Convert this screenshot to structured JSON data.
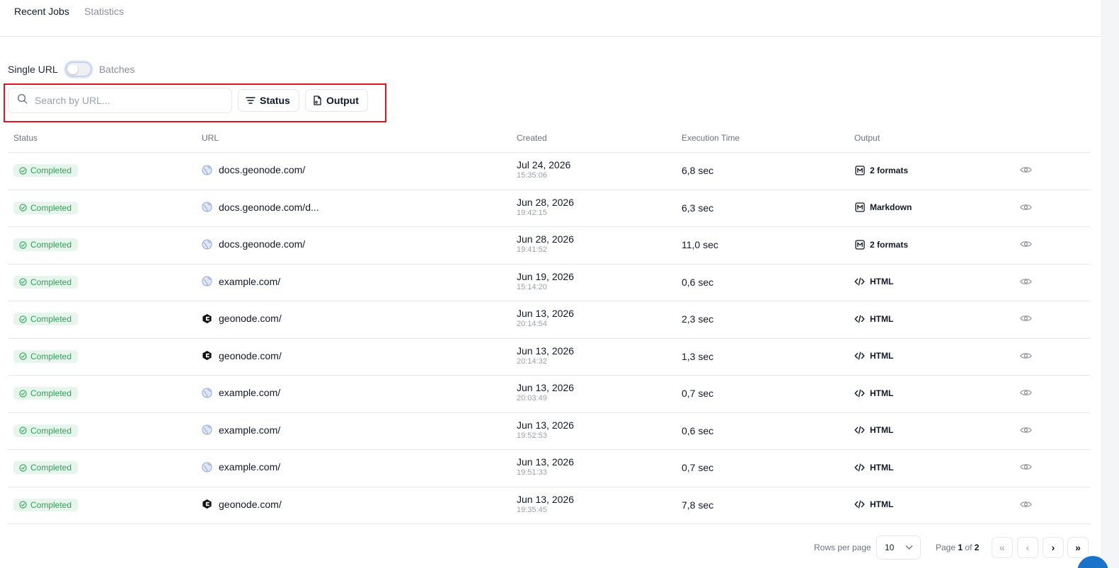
{
  "tabs": {
    "active": "Recent Jobs",
    "inactive": "Statistics"
  },
  "mode": {
    "left_label": "Single URL",
    "right_label": "Batches",
    "toggle_on": false
  },
  "filters": {
    "search_placeholder": "Search by URL...",
    "status_label": "Status",
    "output_label": "Output",
    "highlight_color": "#e0131f"
  },
  "table": {
    "headers": {
      "status": "Status",
      "url": "URL",
      "created": "Created",
      "execution_time": "Execution Time",
      "output": "Output"
    },
    "rows": [
      {
        "status": "Completed",
        "url": "docs.geonode.com/",
        "url_icon": "globe-icon",
        "date": "Jul 24, 2026",
        "time": "15:35:06",
        "exec": "6,8 sec",
        "output": "2 formats",
        "output_icon": "markdown-icon"
      },
      {
        "status": "Completed",
        "url": "docs.geonode.com/d...",
        "url_icon": "globe-icon",
        "date": "Jun 28, 2026",
        "time": "19:42:15",
        "exec": "6,3 sec",
        "output": "Markdown",
        "output_icon": "markdown-icon"
      },
      {
        "status": "Completed",
        "url": "docs.geonode.com/",
        "url_icon": "globe-icon",
        "date": "Jun 28, 2026",
        "time": "19:41:52",
        "exec": "11,0 sec",
        "output": "2 formats",
        "output_icon": "markdown-icon"
      },
      {
        "status": "Completed",
        "url": "example.com/",
        "url_icon": "globe-icon",
        "date": "Jun 19, 2026",
        "time": "15:14:20",
        "exec": "0,6 sec",
        "output": "HTML",
        "output_icon": "code-icon"
      },
      {
        "status": "Completed",
        "url": "geonode.com/",
        "url_icon": "geonode-logo-icon",
        "date": "Jun 13, 2026",
        "time": "20:14:54",
        "exec": "2,3 sec",
        "output": "HTML",
        "output_icon": "code-icon"
      },
      {
        "status": "Completed",
        "url": "geonode.com/",
        "url_icon": "geonode-logo-icon",
        "date": "Jun 13, 2026",
        "time": "20:14:32",
        "exec": "1,3 sec",
        "output": "HTML",
        "output_icon": "code-icon"
      },
      {
        "status": "Completed",
        "url": "example.com/",
        "url_icon": "globe-icon",
        "date": "Jun 13, 2026",
        "time": "20:03:49",
        "exec": "0,7 sec",
        "output": "HTML",
        "output_icon": "code-icon"
      },
      {
        "status": "Completed",
        "url": "example.com/",
        "url_icon": "globe-icon",
        "date": "Jun 13, 2026",
        "time": "19:52:53",
        "exec": "0,6 sec",
        "output": "HTML",
        "output_icon": "code-icon"
      },
      {
        "status": "Completed",
        "url": "example.com/",
        "url_icon": "globe-icon",
        "date": "Jun 13, 2026",
        "time": "19:51:33",
        "exec": "0,7 sec",
        "output": "HTML",
        "output_icon": "code-icon"
      },
      {
        "status": "Completed",
        "url": "geonode.com/",
        "url_icon": "geonode-logo-icon",
        "date": "Jun 13, 2026",
        "time": "19:35:45",
        "exec": "7,8 sec",
        "output": "HTML",
        "output_icon": "code-icon"
      }
    ]
  },
  "pagination": {
    "rows_per_page_label": "Rows per page",
    "rows_per_page": "10",
    "page_prefix": "Page",
    "current": "1",
    "of": "of",
    "total": "2",
    "first": "«",
    "prev": "‹",
    "next": "›",
    "last": "»"
  },
  "colors": {
    "badge_bg": "#e7f6ec",
    "badge_text": "#2f9e58",
    "fab": "#1a73c9"
  }
}
